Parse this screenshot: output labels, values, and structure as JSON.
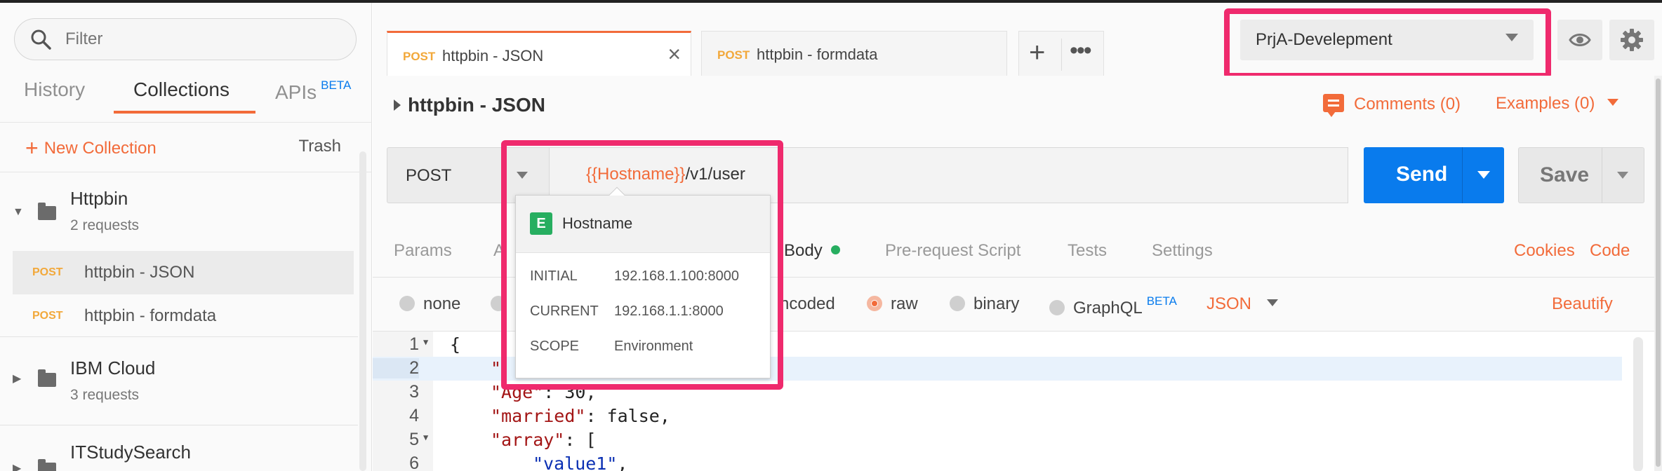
{
  "sidebar": {
    "filter_placeholder": "Filter",
    "tabs": [
      {
        "label": "History"
      },
      {
        "label": "Collections"
      },
      {
        "label": "APIs",
        "badge": "BETA"
      }
    ],
    "new_collection": "New Collection",
    "trash": "Trash",
    "collections": [
      {
        "name": "Httpbin",
        "count": "2 requests",
        "requests": [
          {
            "method": "POST",
            "name": "httpbin - JSON"
          },
          {
            "method": "POST",
            "name": "httpbin - formdata"
          }
        ]
      },
      {
        "name": "IBM Cloud",
        "count": "3 requests"
      },
      {
        "name": "ITStudySearch"
      }
    ]
  },
  "tabs": [
    {
      "method": "POST",
      "title": "httpbin - JSON"
    },
    {
      "method": "POST",
      "title": "httpbin - formdata"
    }
  ],
  "environment": {
    "selected": "PrjA-Develepment"
  },
  "request": {
    "title": "httpbin - JSON",
    "comments": "Comments (0)",
    "examples": "Examples (0)",
    "method": "POST",
    "url_var": "{{Hostname}}",
    "url_path": "/v1/user",
    "send": "Send",
    "save": "Save"
  },
  "request_tabs": {
    "params": "Params",
    "auth_partial": "A",
    "body": "Body",
    "prerequest": "Pre-request Script",
    "tests": "Tests",
    "settings": "Settings",
    "cookies": "Cookies",
    "code": "Code"
  },
  "body_options": {
    "none": "none",
    "urlencoded_partial": "ncoded",
    "raw": "raw",
    "binary": "binary",
    "graphql": "GraphQL",
    "graphql_badge": "BETA",
    "format": "JSON",
    "beautify": "Beautify"
  },
  "editor": {
    "line_numbers": [
      "1",
      "2",
      "3",
      "4",
      "5",
      "6"
    ],
    "l1": "{",
    "l2_quote": "\"",
    "l3_key": "\"Age\"",
    "l3_rest": ": 30,",
    "l4_key": "\"married\"",
    "l4_rest": ": false,",
    "l5_key": "\"array\"",
    "l5_rest": ": [",
    "l6_val": "\"value1\"",
    "l6_rest": ","
  },
  "variable_popup": {
    "scope_badge": "E",
    "name": "Hostname",
    "initial_label": "INITIAL",
    "initial_value": "192.168.1.100:8000",
    "current_label": "CURRENT",
    "current_value": "192.168.1.1:8000",
    "scope_label": "SCOPE",
    "scope_value": "Environment"
  },
  "colors": {
    "accent": "#f26b3a",
    "primary": "#097bed",
    "highlight": "#ef2a6d",
    "env_badge": "#27ae60"
  }
}
